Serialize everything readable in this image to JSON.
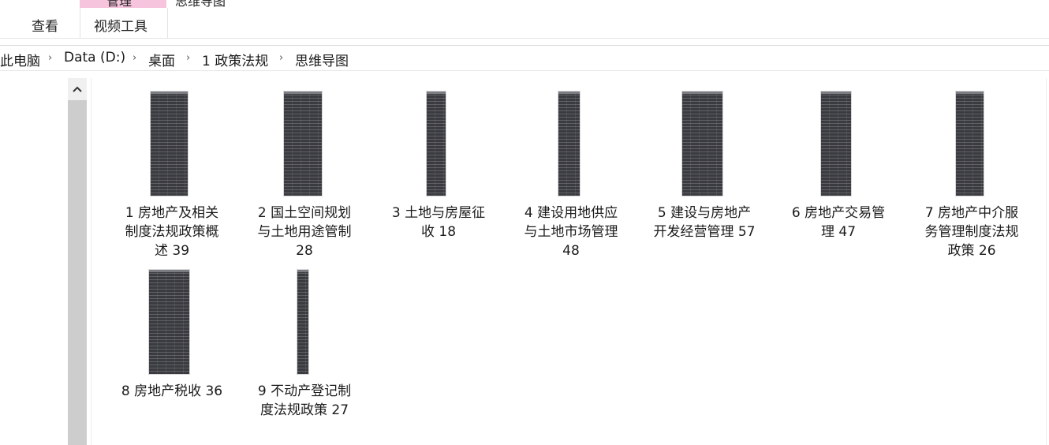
{
  "ribbon": {
    "context_header": "管理",
    "context_group": "思维导图",
    "tabs": {
      "view": "查看",
      "video_tools": "视频工具"
    },
    "context_color": "#f7c4de"
  },
  "breadcrumb": {
    "items": [
      "此电脑",
      "Data (D:)",
      "桌面",
      "1 政策法规",
      "思维导图"
    ],
    "separator": "›"
  },
  "files": [
    {
      "name": "1 房地产及相关制度法规政策概述 39",
      "lines": [
        "1 房地产及相关",
        "制度法规政策概",
        "述 39"
      ]
    },
    {
      "name": "2 国土空间规划与土地用途管制 28",
      "lines": [
        "2 国土空间规划",
        "与土地用途管制",
        "28"
      ]
    },
    {
      "name": "3 土地与房屋征收 18",
      "lines": [
        "3 土地与房屋征",
        "收 18"
      ]
    },
    {
      "name": "4 建设用地供应与土地市场管理 48",
      "lines": [
        "4 建设用地供应",
        "与土地市场管理",
        "48"
      ]
    },
    {
      "name": "5 建设与房地产开发经营管理 57",
      "lines": [
        "5 建设与房地产",
        "开发经营管理 57"
      ]
    },
    {
      "name": "6 房地产交易管理 47",
      "lines": [
        "6 房地产交易管",
        "理 47"
      ]
    },
    {
      "name": "7 房地产中介服务管理制度法规政策 26",
      "lines": [
        "7 房地产中介服",
        "务管理制度法规",
        "政策 26"
      ]
    },
    {
      "name": "8 房地产税收 36",
      "lines": [
        "8 房地产税收 36"
      ]
    },
    {
      "name": "9 不动产登记制度法规政策 27",
      "lines": [
        "9 不动产登记制",
        "度法规政策 27"
      ]
    }
  ],
  "icons": {
    "scroll_up": "chevron-up-icon",
    "separator": "chevron-right-icon"
  }
}
